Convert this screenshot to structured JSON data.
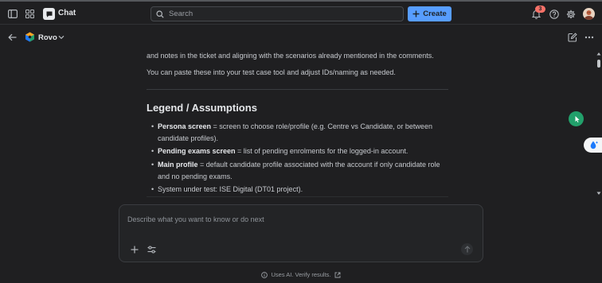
{
  "topbar": {
    "app_name": "Chat",
    "search_placeholder": "Search",
    "create_label": "Create",
    "notification_count": "3"
  },
  "agent": {
    "name": "Rovo"
  },
  "message": {
    "paragraph1": "and notes in the ticket and aligning with the scenarios already mentioned in the comments.",
    "paragraph2": "You can paste these into your test case tool and adjust IDs/naming as needed.",
    "legend_heading": "Legend / Assumptions",
    "bullets": [
      {
        "term": "Persona screen",
        "desc": " = screen to choose role/profile (e.g. Centre vs Candidate, or between candidate profiles)."
      },
      {
        "term": "Pending exams screen",
        "desc": " = list of pending enrolments for the logged-in account."
      },
      {
        "term": "Main profile",
        "desc": " = default candidate profile associated with the account if only candidate role and no pending exams."
      },
      {
        "term": "",
        "desc": "System under test: ISE Digital (DT01 project)."
      }
    ]
  },
  "composer": {
    "placeholder": "Describe what you want to know or do next"
  },
  "footer": {
    "text": "Uses AI. Verify results."
  },
  "colors": {
    "accent": "#579dff",
    "badge": "#f87168",
    "green": "#22a06b",
    "background": "#1f1f21"
  },
  "icons": [
    "sidebar-toggle-icon",
    "apps-grid-icon",
    "chat-app-icon",
    "search-icon",
    "plus-icon",
    "bell-icon",
    "help-icon",
    "gear-icon",
    "back-arrow-icon",
    "rovo-logo-icon",
    "chevron-down-icon",
    "edit-icon",
    "more-icon",
    "attach-plus-icon",
    "settings-sliders-icon",
    "send-arrow-icon",
    "info-icon",
    "external-link-icon"
  ]
}
